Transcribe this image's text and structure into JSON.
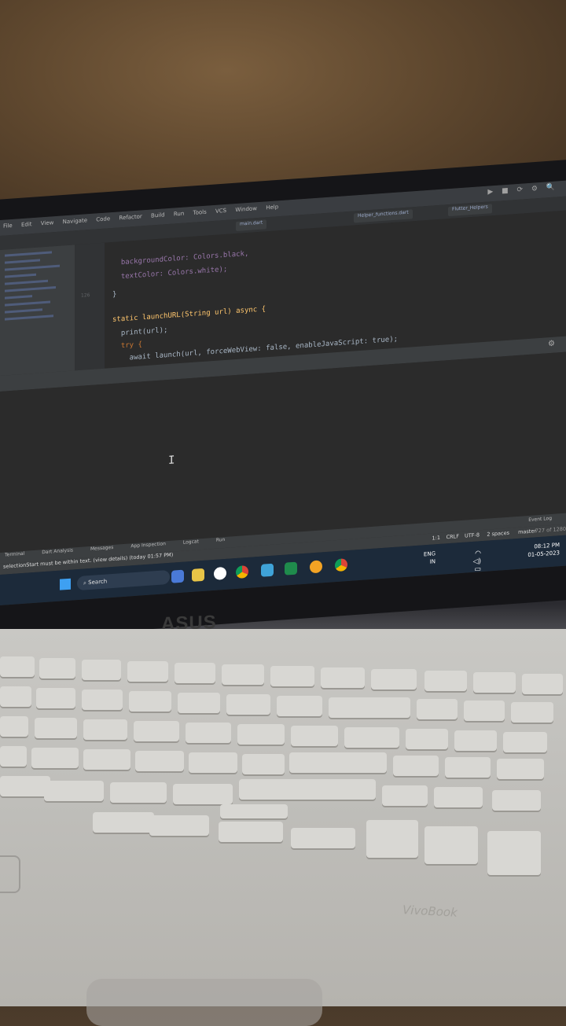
{
  "ide": {
    "menu": [
      "File",
      "Edit",
      "View",
      "Navigate",
      "Code",
      "Refactor",
      "Build",
      "Run",
      "Tools",
      "VCS",
      "Window",
      "Help"
    ],
    "tabs": [
      "main.dart",
      "Helper_functions.dart",
      "Flutter_Helpers"
    ],
    "code_lines": [
      {
        "num": "",
        "text": "  backgroundColor: Colors.black,"
      },
      {
        "num": "",
        "text": "  textColor: Colors.white);"
      },
      {
        "num": "",
        "text": "}"
      },
      {
        "num": "126",
        "text": ""
      },
      {
        "num": "",
        "text": "static launchURL(String url) async {"
      },
      {
        "num": "",
        "text": "  print(url);"
      },
      {
        "num": "",
        "text": "  try {"
      },
      {
        "num": "",
        "text": "    await launch(url, forceWebView: false, enableJavaScript: true);"
      }
    ],
    "bottom_tools": [
      "Terminal",
      "Dart Analysis",
      "Messages",
      "App Inspection",
      "Logcat",
      "Run"
    ],
    "status_message": "selectionStart must be within text. (view details) (today 01:57 PM)",
    "status_right": [
      "1:1",
      "CRLF",
      "UTF-8",
      "2 spaces",
      "master"
    ],
    "event_log": "Event Log",
    "line_count": "727 of 1280"
  },
  "taskbar": {
    "search": "Search",
    "lang": "ENG",
    "region": "IN",
    "time": "08:12 PM",
    "date": "01-05-2023"
  },
  "brand": "ASUS",
  "palmrest_mark": "VivoBook"
}
